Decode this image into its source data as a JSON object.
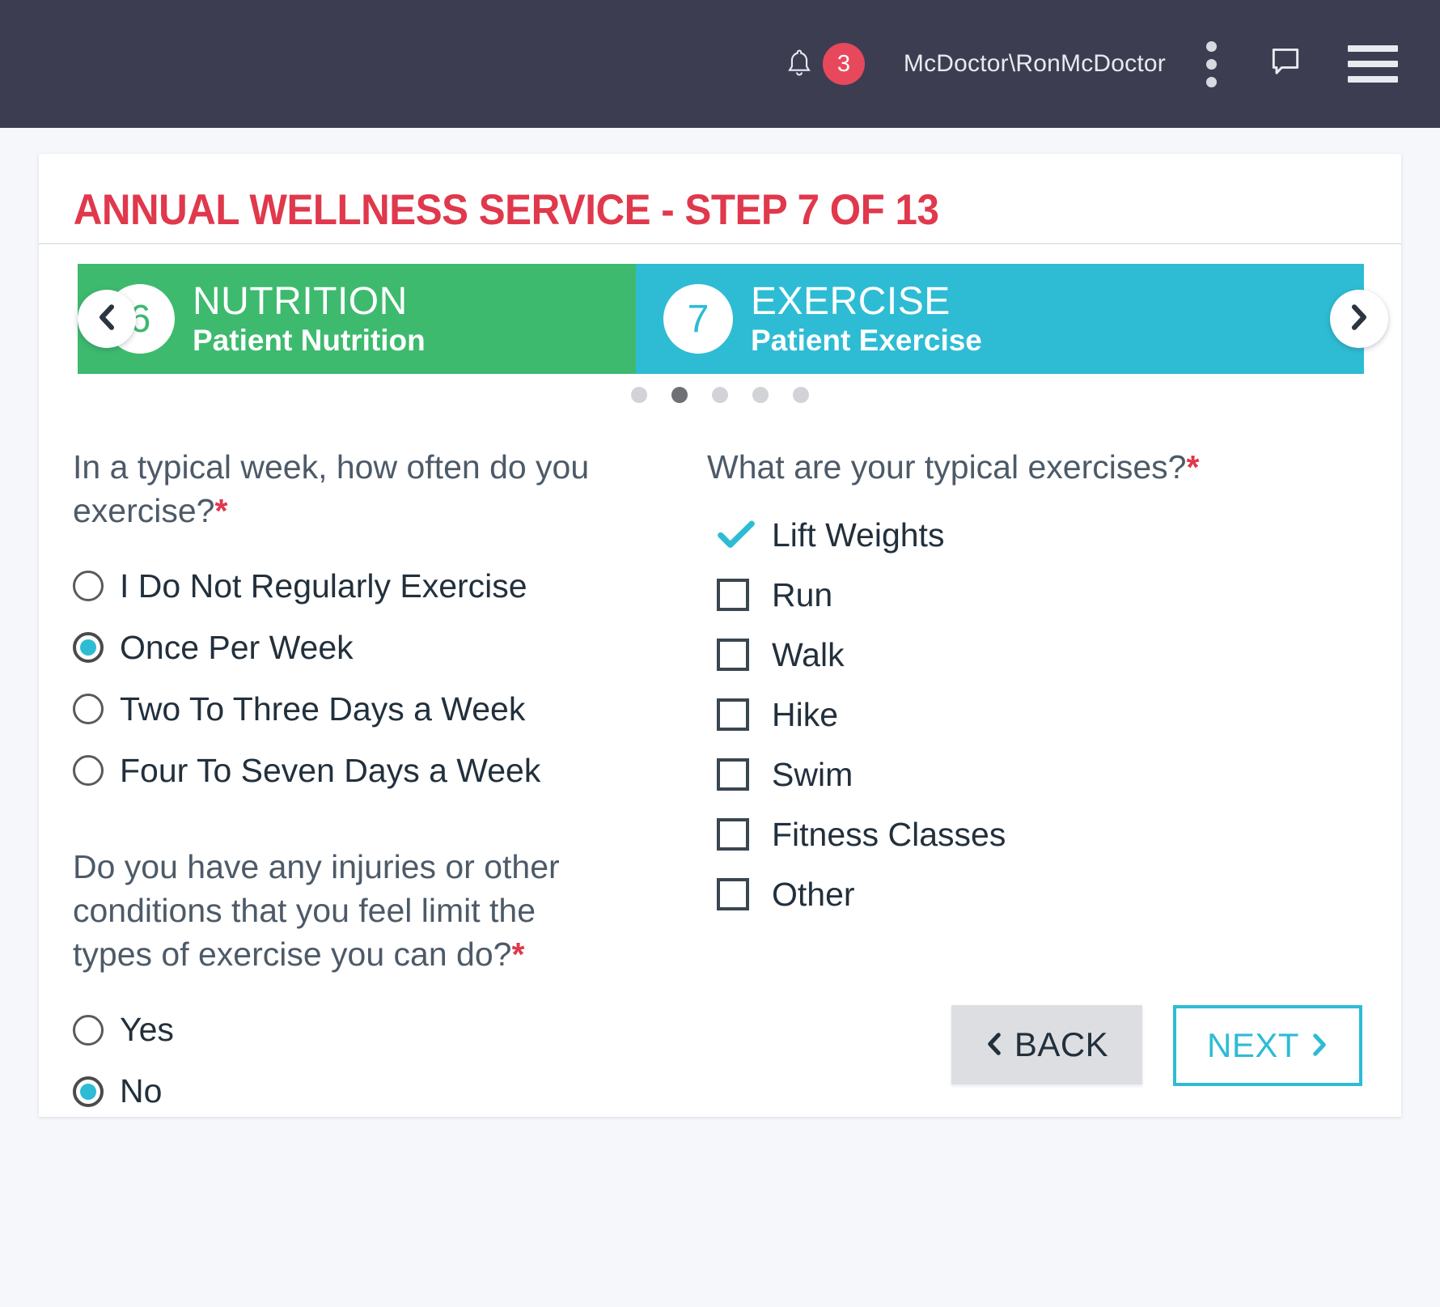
{
  "topbar": {
    "bell_icon": "bell-icon",
    "notification_count": "3",
    "username": "McDoctor\\RonMcDoctor",
    "kebab_icon": "kebab-menu-icon",
    "chat_icon": "chat-bubble-icon",
    "hamburger_icon": "hamburger-menu-icon",
    "background": "#3d3d52",
    "badge_color": "#e8485c"
  },
  "card": {
    "title": "ANNUAL WELLNESS SERVICE - STEP 7 OF 13",
    "title_color": "#e0384c"
  },
  "carousel": {
    "prev_icon": "chevron-left-icon",
    "next_icon": "chevron-right-icon",
    "steps": [
      {
        "number": "6",
        "name": "NUTRITION",
        "subtitle": "Patient Nutrition",
        "color": "#3dba6e"
      },
      {
        "number": "7",
        "name": "EXERCISE",
        "subtitle": "Patient Exercise",
        "color": "#2ebcd4"
      }
    ],
    "dots": [
      {
        "active": false
      },
      {
        "active": true
      },
      {
        "active": false
      },
      {
        "active": false
      },
      {
        "active": false
      }
    ]
  },
  "form": {
    "left": {
      "question1": {
        "text": "In a typical week, how often do you exercise?",
        "required_marker": "*",
        "options": [
          {
            "label": "I Do Not Regularly Exercise",
            "selected": false
          },
          {
            "label": "Once Per Week",
            "selected": true
          },
          {
            "label": "Two To Three Days a Week",
            "selected": false
          },
          {
            "label": "Four To Seven Days a Week",
            "selected": false
          }
        ]
      },
      "question2": {
        "text": "Do you have any injuries or other conditions that you feel limit the types of exercise you can do?",
        "required_marker": "*",
        "options": [
          {
            "label": "Yes",
            "selected": false
          },
          {
            "label": "No",
            "selected": true
          }
        ]
      }
    },
    "right": {
      "question3": {
        "text": "What are your typical exercises?",
        "required_marker": "*",
        "options": [
          {
            "label": "Lift Weights",
            "checked": true
          },
          {
            "label": "Run",
            "checked": false
          },
          {
            "label": "Walk",
            "checked": false
          },
          {
            "label": "Hike",
            "checked": false
          },
          {
            "label": "Swim",
            "checked": false
          },
          {
            "label": "Fitness Classes",
            "checked": false
          },
          {
            "label": "Other",
            "checked": false
          }
        ]
      }
    }
  },
  "buttons": {
    "back": {
      "label": "BACK",
      "icon": "chevron-left-icon"
    },
    "next": {
      "label": "NEXT",
      "icon": "chevron-right-icon"
    }
  },
  "colors": {
    "accent_cyan": "#2ebcd4",
    "accent_green": "#3dba6e",
    "accent_red": "#e0384c",
    "text_dark": "#22303c",
    "text_muted": "#4d5a68"
  }
}
